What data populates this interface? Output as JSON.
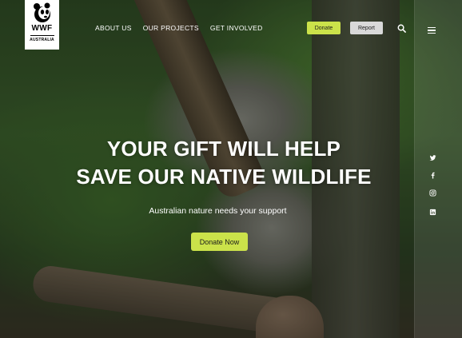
{
  "logo": {
    "wordmark": "WWF",
    "region": "AUSTRALIA"
  },
  "nav": {
    "items": [
      "ABOUT US",
      "OUR PROJECTS",
      "GET INVOLVED"
    ]
  },
  "header": {
    "donate_label": "Donate",
    "report_label": "Report"
  },
  "icons": {
    "search": "search-icon",
    "menu": "hamburger-menu-icon",
    "social": [
      "twitter-icon",
      "facebook-icon",
      "instagram-icon",
      "linkedin-icon"
    ]
  },
  "hero": {
    "headline_line1": "YOUR GIFT WILL HELP",
    "headline_line2": "SAVE OUR NATIVE WILDLIFE",
    "subtitle": "Australian nature needs your support",
    "cta_label": "Donate Now"
  },
  "colors": {
    "accent": "#cbe24a",
    "report_button": "#d9d9d9",
    "logo_bg": "#ffffff"
  }
}
